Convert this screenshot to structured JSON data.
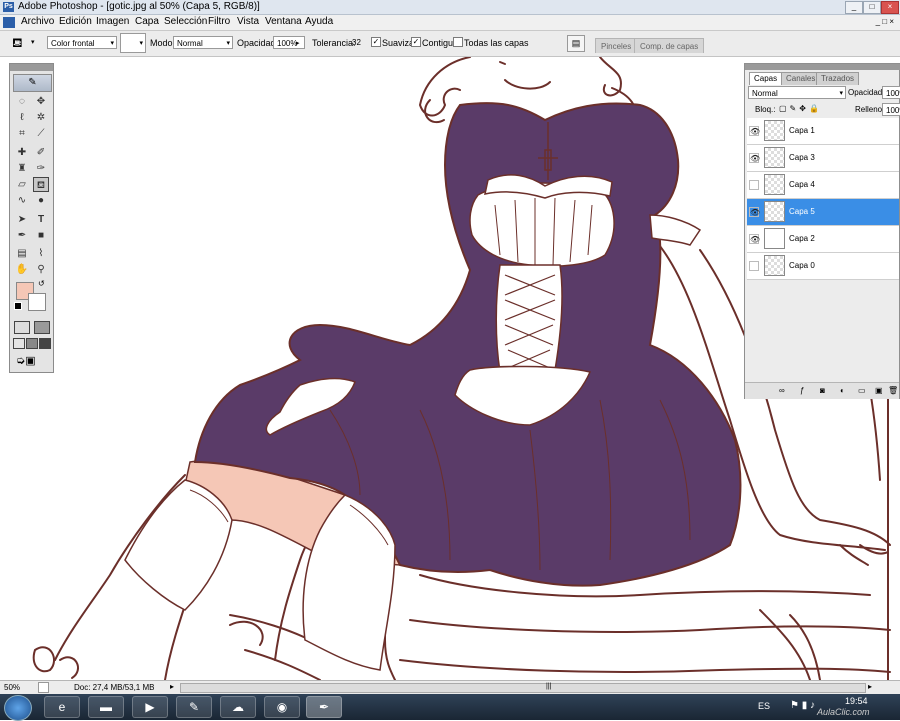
{
  "window": {
    "title": "Adobe Photoshop - [gotic.jpg al 50% (Capa 5, RGB/8)]",
    "app_icon": "Ps",
    "buttons": [
      "_",
      "□",
      "×"
    ]
  },
  "menu": [
    "Archivo",
    "Edición",
    "Imagen",
    "Capa",
    "Selección",
    "Filtro",
    "Vista",
    "Ventana",
    "Ayuda"
  ],
  "options": {
    "fill_source": "Color frontal",
    "mode_label": "Modo:",
    "mode_value": "Normal",
    "opacity_label": "Opacidad:",
    "opacity_value": "100%",
    "tolerance_label": "Tolerancia:",
    "tolerance_value": "32",
    "antialias_label": "Suavizar",
    "antialias_checked": true,
    "contiguous_label": "Contiguo",
    "contiguous_checked": true,
    "all_layers_label": "Todas las capas",
    "all_layers_checked": false,
    "dock_tabs": [
      "Pinceles",
      "Comp. de capas"
    ]
  },
  "toolbox": {
    "tools": [
      "marquee",
      "move",
      "lasso",
      "magic-wand",
      "crop",
      "slice",
      "healing",
      "brush",
      "stamp",
      "history-brush",
      "eraser",
      "paint-bucket",
      "blur",
      "dodge",
      "path-select",
      "type",
      "pen",
      "shape",
      "notes",
      "eyedropper",
      "hand",
      "zoom"
    ]
  },
  "layers_panel": {
    "tabs": [
      "Capas",
      "Canales",
      "Trazados"
    ],
    "blend_mode": "Normal",
    "opacity_label": "Opacidad:",
    "opacity_value": "100%",
    "lock_label": "Bloq.:",
    "fill_label": "Relleno:",
    "fill_value": "100%",
    "layers": [
      {
        "name": "Capa 1",
        "visible": true,
        "selected": false
      },
      {
        "name": "Capa 3",
        "visible": true,
        "selected": false
      },
      {
        "name": "Capa 4",
        "visible": false,
        "selected": false
      },
      {
        "name": "Capa 5",
        "visible": true,
        "selected": true
      },
      {
        "name": "Capa 2",
        "visible": true,
        "selected": false
      },
      {
        "name": "Capa 0",
        "visible": false,
        "selected": false
      }
    ]
  },
  "status": {
    "zoom": "50%",
    "doc": "Doc: 27,4 MB/53,1 MB"
  },
  "taskbar": {
    "language": "ES",
    "time": "19:54",
    "watermark": "AulaClic.com"
  },
  "colors": {
    "dress": "#5a3b68",
    "skin": "#f5c7b6",
    "lineart": "#6b2f2a",
    "selected_layer": "#3a8ee6"
  }
}
